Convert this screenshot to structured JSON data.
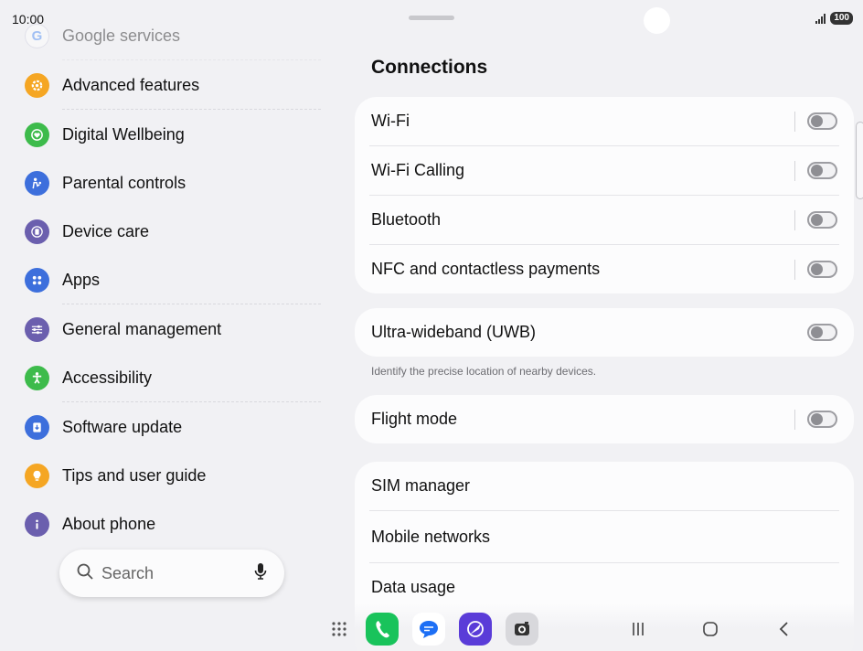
{
  "status_bar": {
    "time": "10:00",
    "battery": "100"
  },
  "left_menu": {
    "items": [
      {
        "label": "Google services",
        "icon": "google-icon",
        "color": "#4285f4"
      },
      {
        "label": "Advanced features",
        "icon": "gear-star-icon",
        "color": "#f5a623"
      },
      {
        "label": "Digital Wellbeing",
        "icon": "heart-icon",
        "color": "#3dbb4b"
      },
      {
        "label": "Parental controls",
        "icon": "parent-child-icon",
        "color": "#3d6fdc"
      },
      {
        "label": "Device care",
        "icon": "device-care-icon",
        "color": "#6b5fae"
      },
      {
        "label": "Apps",
        "icon": "apps-grid-icon",
        "color": "#3d6fdc"
      },
      {
        "label": "General management",
        "icon": "sliders-icon",
        "color": "#6b5fae"
      },
      {
        "label": "Accessibility",
        "icon": "accessibility-icon",
        "color": "#3dbb4b"
      },
      {
        "label": "Software update",
        "icon": "software-update-icon",
        "color": "#3d6fdc"
      },
      {
        "label": "Tips and user guide",
        "icon": "lightbulb-icon",
        "color": "#f5a623"
      },
      {
        "label": "About phone",
        "icon": "info-icon",
        "color": "#6b5fae"
      }
    ],
    "search": {
      "label": "Search"
    }
  },
  "connections": {
    "title": "Connections",
    "group1": [
      {
        "label": "Wi-Fi",
        "on": false
      },
      {
        "label": "Wi-Fi Calling",
        "on": false
      },
      {
        "label": "Bluetooth",
        "on": false
      },
      {
        "label": "NFC and contactless payments",
        "on": false
      }
    ],
    "uwb": {
      "label": "Ultra-wideband (UWB)",
      "on": false,
      "caption": "Identify the precise location of nearby devices."
    },
    "flight": {
      "label": "Flight mode",
      "on": false
    },
    "group3": [
      {
        "label": "SIM manager"
      },
      {
        "label": "Mobile networks"
      },
      {
        "label": "Data usage"
      }
    ]
  },
  "dock": {
    "apps": [
      {
        "name": "phone-app-icon",
        "color": "#19c35b"
      },
      {
        "name": "messages-app-icon",
        "color": "#ffffff"
      },
      {
        "name": "internet-app-icon",
        "color": "#5a3cd8"
      },
      {
        "name": "camera-app-icon",
        "color": "#d8d8dc"
      }
    ]
  },
  "colors": {
    "background": "#f1f1f4",
    "card": "#fcfcfd",
    "accent": "#3d6fdc"
  }
}
